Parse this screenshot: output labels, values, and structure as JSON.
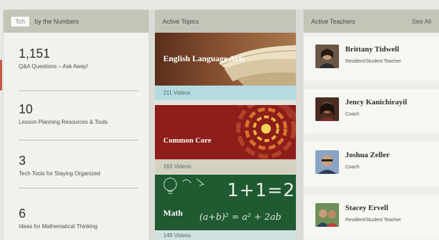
{
  "numbers_panel": {
    "tag": "Tch",
    "header": "by the Numbers",
    "stats": [
      {
        "number": "1,151",
        "label": "Q&A Questions – Ask Away!"
      },
      {
        "number": "10",
        "label": "Lesson Planning Resources & Tools"
      },
      {
        "number": "3",
        "label": "Tech Tools for Staying Organized"
      },
      {
        "number": "6",
        "label": "Ideas for Mathematical Thinking"
      }
    ]
  },
  "topics_panel": {
    "header": "Active Topics",
    "topics": [
      {
        "title": "English Language Arts",
        "count": "211 Videos"
      },
      {
        "title": "Common Core",
        "count": "163 Videos"
      },
      {
        "title": "Math",
        "count": "148 Videos",
        "chalk": "1+1=2",
        "formula": "(a+b)² = a² + 2ab"
      }
    ]
  },
  "teachers_panel": {
    "header": "Active Teachers",
    "see_all": "See All",
    "teachers": [
      {
        "name": "Brittany Tidwell",
        "role": "Resident/Student Teacher"
      },
      {
        "name": "Jency Kanichirayil",
        "role": "Coach"
      },
      {
        "name": "Joshua Zeller",
        "role": "Coach"
      },
      {
        "name": "Stacey Ervell",
        "role": "Resident/Student Teacher"
      }
    ]
  },
  "colors": {
    "header_bg": "#c5c4b8",
    "ela_count_bg": "#b5dbe0",
    "core_count_bg": "#d3d1bf",
    "math_count_bg": "#cfe2e0"
  }
}
